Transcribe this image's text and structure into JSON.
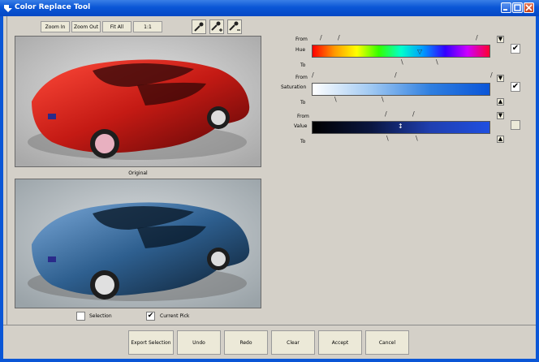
{
  "window": {
    "title": "Color Replace Tool"
  },
  "toolbar": {
    "zoom_in": "Zoom In",
    "zoom_out": "Zoom Out",
    "fit_all": "Fit All",
    "one_to_one": "1:1"
  },
  "preview": {
    "original_caption": "Original",
    "selection_label": "Selection",
    "selection_checked": false,
    "current_pick_label": "Current Pick",
    "current_pick_checked": true
  },
  "controls": {
    "from_label": "From",
    "to_label": "To",
    "hue_label": "Hue",
    "saturation_label": "Saturation",
    "value_label": "Value",
    "hue_enabled": true,
    "saturation_enabled": true,
    "value_enabled": false
  },
  "buttons": {
    "export_selection": "Export Selection",
    "undo": "Undo",
    "redo": "Redo",
    "clear": "Clear",
    "accept": "Accept",
    "cancel": "Cancel"
  },
  "icons": {
    "window": "color-replace-icon",
    "picker": "eyedropper-icon",
    "picker_add": "eyedropper-plus-icon",
    "picker_remove": "eyedropper-minus-icon"
  },
  "colors": {
    "title_bar": "#0a56d6",
    "original_car": "#c41a14",
    "replaced_car": "#2e5f8f"
  }
}
